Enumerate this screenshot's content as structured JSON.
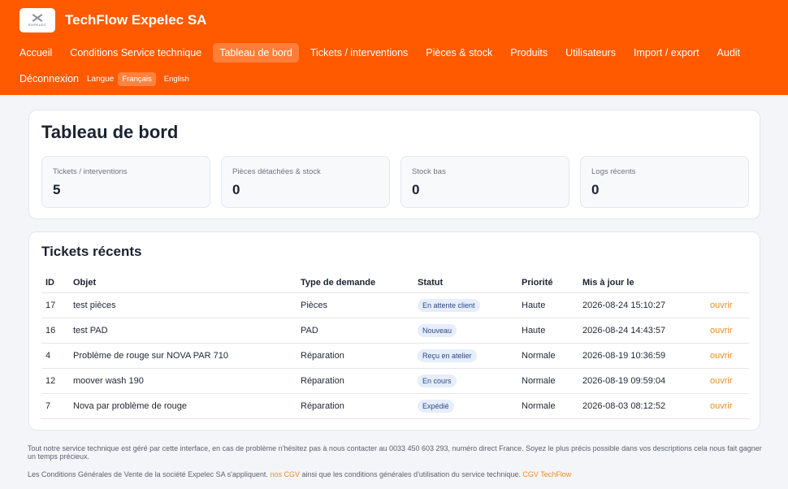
{
  "brand": {
    "name": "TechFlow Expelec SA",
    "logo_text": "EXPELEC"
  },
  "nav": {
    "items": [
      "Accueil",
      "Conditions Service technique",
      "Tableau de bord",
      "Tickets / interventions",
      "Pièces & stock",
      "Produits",
      "Utilisateurs",
      "Import / export",
      "Audit"
    ],
    "logout": "Déconnexion",
    "lang_label": "Langue",
    "lang_fr": "Français",
    "lang_en": "English"
  },
  "dashboard": {
    "title": "Tableau de bord",
    "stats": [
      {
        "label": "Tickets / interventions",
        "value": "5"
      },
      {
        "label": "Pièces détachées & stock",
        "value": "0"
      },
      {
        "label": "Stock bas",
        "value": "0"
      },
      {
        "label": "Logs récents",
        "value": "0"
      }
    ]
  },
  "recent": {
    "title": "Tickets récents",
    "columns": [
      "ID",
      "Objet",
      "Type de demande",
      "Statut",
      "Priorité",
      "Mis à jour le"
    ],
    "open_label": "ouvrir",
    "rows": [
      {
        "id": "17",
        "subject": "test pièces",
        "type": "Pièces",
        "status": "En attente client",
        "priority": "Haute",
        "updated": "2026-08-24 15:10:27"
      },
      {
        "id": "16",
        "subject": "test PAD",
        "type": "PAD",
        "status": "Nouveau",
        "priority": "Haute",
        "updated": "2026-08-24 14:43:57"
      },
      {
        "id": "4",
        "subject": "Problème de rouge sur NOVA PAR 710",
        "type": "Réparation",
        "status": "Reçu en atelier",
        "priority": "Normale",
        "updated": "2026-08-19 10:36:59"
      },
      {
        "id": "12",
        "subject": "moover wash 190",
        "type": "Réparation",
        "status": "En cours",
        "priority": "Normale",
        "updated": "2026-08-19 09:59:04"
      },
      {
        "id": "7",
        "subject": "Nova par problème de rouge",
        "type": "Réparation",
        "status": "Expédié",
        "priority": "Normale",
        "updated": "2026-08-03 08:12:52"
      }
    ]
  },
  "footer": {
    "line1": "Tout notre service technique est géré par cette interface, en cas de problème n'hésitez pas à nous contacter au 0033 450 603 293, numéro direct France. Soyez le plus précis possible dans vos descriptions cela nous fait gagner un temps précieux.",
    "line2_a": "Les Conditions Générales de Vente de la société Expelec SA s'appliquent.",
    "link_cgv": "nos CGV",
    "line2_b": "ainsi que les conditions générales d'utilisation du service technique.",
    "link_techflow": "CGV TechFlow"
  },
  "colors": {
    "accent": "#ff5a00",
    "link": "#f08a24",
    "badge_bg": "#e6edfb"
  }
}
